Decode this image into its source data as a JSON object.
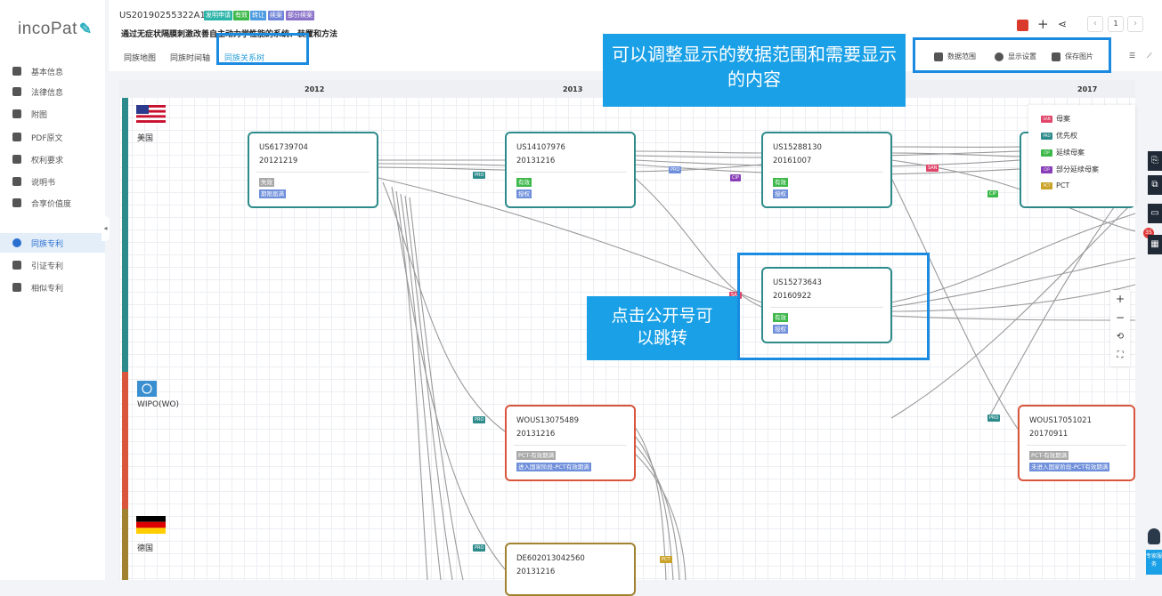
{
  "sidebar": {
    "logo": "incoPat",
    "items": [
      {
        "label": "基本信息",
        "icon": "document-icon"
      },
      {
        "label": "法律信息",
        "icon": "gavel-icon"
      },
      {
        "label": "附图",
        "icon": "image-icon"
      },
      {
        "label": "PDF原文",
        "icon": "pdf-icon"
      },
      {
        "label": "权利要求",
        "icon": "claims-icon"
      },
      {
        "label": "说明书",
        "icon": "book-icon"
      },
      {
        "label": "合享价值度",
        "icon": "diamond-icon"
      },
      {
        "label": "同族专利",
        "icon": "family-icon",
        "active": true
      },
      {
        "label": "引证专利",
        "icon": "citation-icon"
      },
      {
        "label": "相似专利",
        "icon": "similar-icon"
      }
    ]
  },
  "header": {
    "patent_no": "US20190255322A1",
    "badges": [
      {
        "label": "发明申请",
        "color": "#2bb4a8"
      },
      {
        "label": "有效",
        "color": "#3db84a"
      },
      {
        "label": "转让",
        "color": "#4e9be0"
      },
      {
        "label": "续案",
        "color": "#6f84d8"
      },
      {
        "label": "部分续案",
        "color": "#8a72c8"
      }
    ],
    "title": "通过无症状隔膜刺激改善自主动力学性能的系统、装置和方法",
    "tabs": [
      "同族地图",
      "同族时间轴",
      "同族关系树"
    ],
    "active_tab": "同族关系树",
    "actions": {
      "data_range": "数据范围",
      "display_settings": "显示设置",
      "save_image": "保存图片"
    },
    "page": "1"
  },
  "callouts": {
    "top": "可以调整显示的数据范围和需要显示的内容",
    "middle": "点击公开号可以跳转"
  },
  "timeline": {
    "years": [
      "2012",
      "2013",
      "2017"
    ]
  },
  "countries": [
    {
      "label": "美国",
      "color": "#2e8b8b"
    },
    {
      "label": "WIPO(WO)",
      "color": "#d9553b"
    },
    {
      "label": "德国",
      "color": "#a08230"
    }
  ],
  "cards": [
    {
      "no": "US61739704",
      "date": "20121219",
      "tags": [
        {
          "t": "失效",
          "c": "grey"
        },
        {
          "t": "期限届满",
          "c": "blue"
        }
      ]
    },
    {
      "no": "US14107976",
      "date": "20131216",
      "tags": [
        {
          "t": "有效",
          "c": "green"
        },
        {
          "t": "授权",
          "c": "blue"
        }
      ]
    },
    {
      "no": "US15288130",
      "date": "20161007",
      "tags": [
        {
          "t": "有效",
          "c": "green"
        },
        {
          "t": "授权",
          "c": "blue"
        }
      ]
    },
    {
      "no": "US15273643",
      "date": "20160922",
      "tags": [
        {
          "t": "有效",
          "c": "green"
        },
        {
          "t": "授权",
          "c": "blue"
        }
      ]
    },
    {
      "no": "WOUS13075489",
      "date": "20131216",
      "tags": [
        {
          "t": "PCT-有效期满",
          "c": "grey"
        },
        {
          "t": "进入国家阶段-PCT有效期满",
          "c": "blue"
        }
      ]
    },
    {
      "no": "WOUS17051021",
      "date": "20170911",
      "tags": [
        {
          "t": "PCT-有效期满",
          "c": "grey"
        },
        {
          "t": "未进入国家阶段-PCT有效期满",
          "c": "blue"
        }
      ]
    },
    {
      "no": "DE602013042560",
      "date": "20131216",
      "tags": []
    }
  ],
  "legend": [
    {
      "label": "母案",
      "code": "SAN",
      "color": "#e0456a"
    },
    {
      "label": "优先权",
      "code": "PRO",
      "color": "#2e8b8b"
    },
    {
      "label": "延续母案",
      "code": "CIP",
      "color": "#3db84a"
    },
    {
      "label": "部分延续母案",
      "code": "CIP",
      "color": "#8a3fb8"
    },
    {
      "label": "PCT",
      "code": "PCT",
      "color": "#c9a227"
    }
  ],
  "edge_labels": [
    "PRO",
    "PRO",
    "CIP",
    "SAN",
    "CIP",
    "SAN",
    "PRO",
    "PRO",
    "PRO",
    "PCT"
  ],
  "zoom_controls": [
    "+",
    "−",
    "⟲",
    "⛶"
  ],
  "right_tools": {
    "badge_count": "35"
  },
  "assistant": "专家服务"
}
